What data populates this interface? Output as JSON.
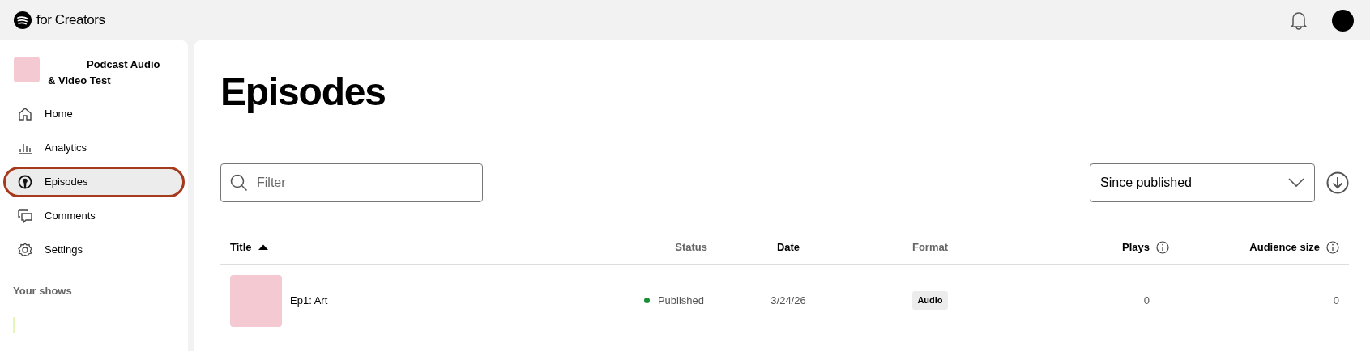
{
  "header": {
    "brand": "for Creators"
  },
  "sidebar": {
    "show_title": "Podcast Audio & Video Test",
    "items": [
      {
        "label": "Home",
        "selected": false
      },
      {
        "label": "Analytics",
        "selected": false
      },
      {
        "label": "Episodes",
        "selected": true
      },
      {
        "label": "Comments",
        "selected": false
      },
      {
        "label": "Settings",
        "selected": false
      }
    ],
    "section_title": "Your shows"
  },
  "main": {
    "title": "Episodes",
    "filter": {
      "placeholder": "Filter"
    },
    "range_select": {
      "value": "Since published"
    }
  },
  "table": {
    "columns": [
      {
        "label": "Title",
        "muted": false,
        "sorted": true,
        "info": false
      },
      {
        "label": "Status",
        "muted": true,
        "sorted": false,
        "info": false
      },
      {
        "label": "Date",
        "muted": false,
        "sorted": false,
        "info": false
      },
      {
        "label": "Format",
        "muted": true,
        "sorted": false,
        "info": false
      },
      {
        "label": "Plays",
        "muted": false,
        "sorted": false,
        "info": true
      },
      {
        "label": "Audience size",
        "muted": false,
        "sorted": false,
        "info": true
      }
    ],
    "rows": [
      {
        "title": "Ep1: Art",
        "status": "Published",
        "color": "#1a8f37",
        "date": "3/24/26",
        "format": "Audio",
        "plays": "0",
        "audience": "0"
      }
    ]
  }
}
